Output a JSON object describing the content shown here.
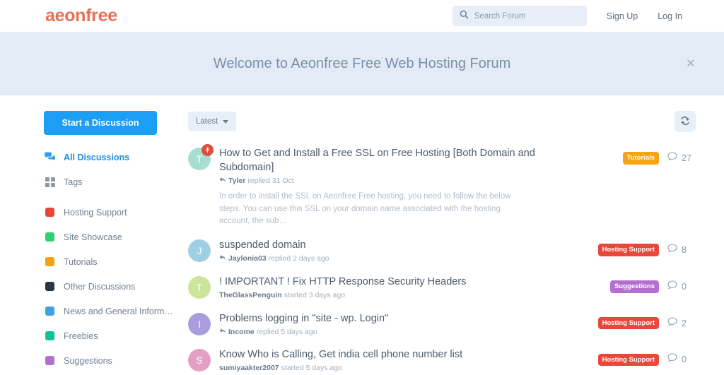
{
  "header": {
    "logo": "aeonfree",
    "search": {
      "placeholder": "Search Forum",
      "value": "",
      "icon": "search-icon"
    },
    "sign_up": "Sign Up",
    "log_in": "Log In"
  },
  "welcome_banner": {
    "title": "Welcome to Aeonfree Free Web Hosting Forum",
    "close_label": "✕",
    "background": "#e3ecf6"
  },
  "sidebar": {
    "start_button": "Start a Discussion",
    "nav": [
      {
        "label": "All Discussions",
        "icon": "discussions-icon",
        "active": true
      },
      {
        "label": "Tags",
        "icon": "tags-grid-icon",
        "active": false
      }
    ],
    "tags": [
      {
        "label": "Hosting Support",
        "color": "#e8473a"
      },
      {
        "label": "Site Showcase",
        "color": "#2fd06b"
      },
      {
        "label": "Tutorials",
        "color": "#f5a312"
      },
      {
        "label": "Other Discussions",
        "color": "#2a3545"
      },
      {
        "label": "News and General Inform…",
        "color": "#3ea1e0"
      },
      {
        "label": "Freebies",
        "color": "#12c29a"
      },
      {
        "label": "Suggestions",
        "color": "#b46fd1"
      }
    ]
  },
  "toolbar": {
    "sort_label": "Latest",
    "sort_icon": "chevron-down-icon",
    "refresh_icon": "refresh-icon"
  },
  "discussions": [
    {
      "avatar_letter": "T",
      "avatar_color": "#a8ddd4",
      "pinned": true,
      "pin_icon": "pin-icon",
      "title": "How to Get and Install a Free SSL on Free Hosting [Both Domain and Subdomain]",
      "author": "Tyler",
      "action": "replied 31 Oct",
      "has_reply_arrow": true,
      "excerpt": "In order to install the SSL on Aeonfree Free hosting, you need to follow the below steps. You can use this SSL on your domain name associated with the hosting account, the sub…",
      "tag": "Tutorials",
      "tag_color": "#f5a312",
      "comments": "27"
    },
    {
      "avatar_letter": "J",
      "avatar_color": "#9ecfe3",
      "pinned": false,
      "title": "suspended domain",
      "author": "Jaylonia03",
      "action": "replied 2 days ago",
      "has_reply_arrow": true,
      "excerpt": "",
      "tag": "Hosting Support",
      "tag_color": "#e8473a",
      "comments": "8"
    },
    {
      "avatar_letter": "T",
      "avatar_color": "#cde49b",
      "pinned": false,
      "title": "! IMPORTANT ! Fix HTTP Response Security Headers",
      "author": "TheGlassPenguin",
      "action": "started 3 days ago",
      "has_reply_arrow": false,
      "excerpt": "",
      "tag": "Suggestions",
      "tag_color": "#b46fd1",
      "comments": "0"
    },
    {
      "avatar_letter": "I",
      "avatar_color": "#a99de0",
      "pinned": false,
      "title": "Problems logging in \"site - wp. Login\"",
      "author": "Income",
      "action": "replied 5 days ago",
      "has_reply_arrow": true,
      "excerpt": "",
      "tag": "Hosting Support",
      "tag_color": "#e8473a",
      "comments": "2"
    },
    {
      "avatar_letter": "S",
      "avatar_color": "#e3a0c4",
      "pinned": false,
      "title": "Know Who is Calling, Get india cell phone number list",
      "author": "sumiyaakter2007",
      "action": "started 5 days ago",
      "has_reply_arrow": false,
      "excerpt": "",
      "tag": "Hosting Support",
      "tag_color": "#e8473a",
      "comments": "0"
    }
  ],
  "colors": {
    "accent_blue": "#1b9ef3",
    "logo_coral": "#e8705a",
    "banner_blue": "#e3ecf6"
  }
}
